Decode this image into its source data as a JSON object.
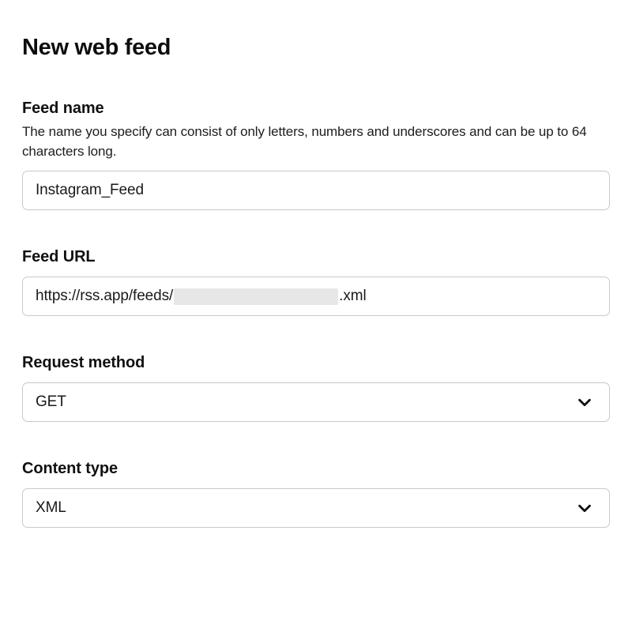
{
  "page": {
    "title": "New web feed",
    "background_color": "#ffffff",
    "text_color": "#111111",
    "border_color": "#c9c9c9",
    "redaction_color": "#e7e7e8"
  },
  "form": {
    "feed_name": {
      "label": "Feed name",
      "help": "The name you specify can consist of only letters, numbers and underscores and can be up to 64 characters long.",
      "value": "Instagram_Feed",
      "placeholder": "Feed name"
    },
    "feed_url": {
      "label": "Feed URL",
      "value_prefix": "https://rss.app/feeds/",
      "value_redacted": true,
      "value_suffix": ".xml",
      "placeholder": "Feed URL"
    },
    "request_method": {
      "label": "Request method",
      "value": "GET",
      "icon": "chevron-down-icon"
    },
    "content_type": {
      "label": "Content type",
      "value": "XML",
      "icon": "chevron-down-icon"
    }
  }
}
